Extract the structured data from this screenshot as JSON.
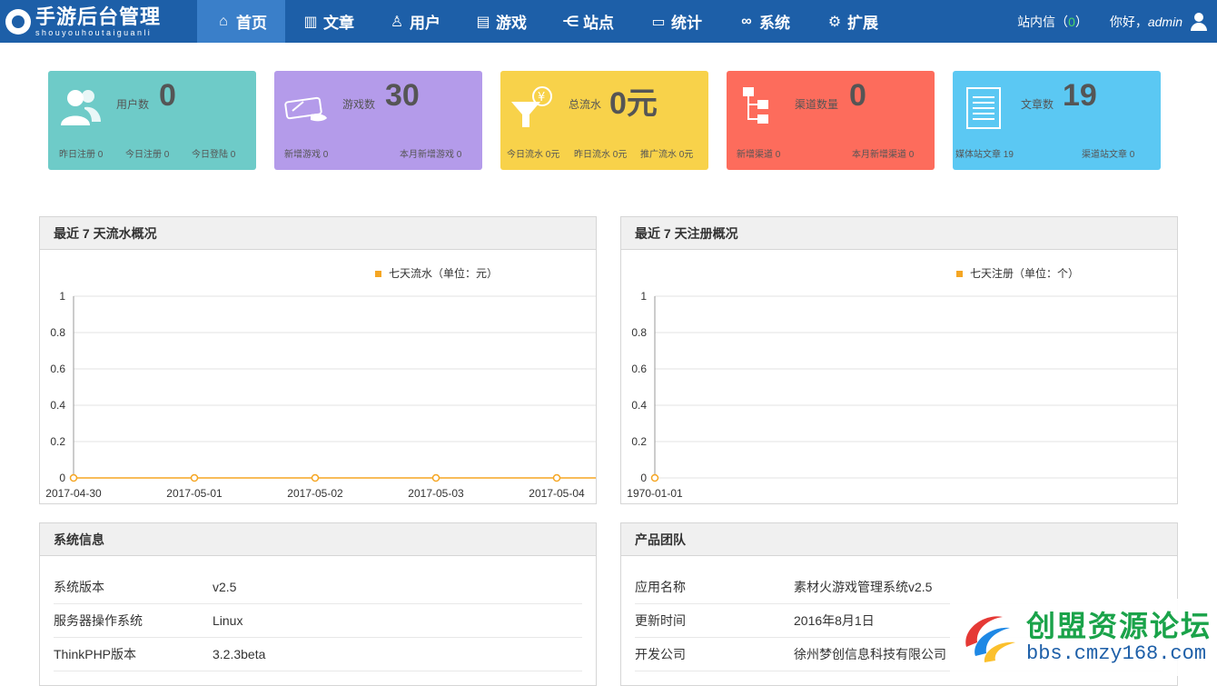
{
  "brand": {
    "title": "手游后台管理",
    "subtitle": "shouyouhoutaiguanli"
  },
  "nav": [
    {
      "label": "首页",
      "icon": "home-icon",
      "glyph": "⌂",
      "active": true
    },
    {
      "label": "文章",
      "icon": "bar-chart-icon",
      "glyph": "▥",
      "active": false
    },
    {
      "label": "用户",
      "icon": "user-sitemap-icon",
      "glyph": "♙",
      "active": false
    },
    {
      "label": "游戏",
      "icon": "document-icon",
      "glyph": "▤",
      "active": false
    },
    {
      "label": "站点",
      "icon": "share-icon",
      "glyph": "⋲",
      "active": false
    },
    {
      "label": "统计",
      "icon": "monitor-icon",
      "glyph": "▭",
      "active": false
    },
    {
      "label": "系统",
      "icon": "link-icon",
      "glyph": "∞",
      "active": false
    },
    {
      "label": "扩展",
      "icon": "gear-icon",
      "glyph": "⚙",
      "active": false
    }
  ],
  "topright": {
    "messages_label": "站内信（",
    "messages_count": "0",
    "messages_close": "）",
    "greeting": "你好，",
    "user": "admin"
  },
  "cards": [
    {
      "label": "用户数",
      "value": "0",
      "color": "#6ecbc8",
      "subs": [
        "昨日注册 0",
        "今日注册 0",
        "今日登陆 0"
      ]
    },
    {
      "label": "游戏数",
      "value": "30",
      "color": "#b49bea",
      "subs": [
        "新增游戏 0",
        "本月新增游戏 0"
      ]
    },
    {
      "label": "总流水",
      "value": "0元",
      "color": "#f8d24a",
      "subs": [
        "今日流水 0元",
        "昨日流水 0元",
        "推广流水 0元"
      ]
    },
    {
      "label": "渠道数量",
      "value": "0",
      "color": "#fd6c5c",
      "subs": [
        "新增渠道 0",
        "本月新增渠道 0"
      ]
    },
    {
      "label": "文章数",
      "value": "19",
      "color": "#5bc8f3",
      "subs": [
        "媒体站文章 19",
        "渠道站文章 0"
      ]
    }
  ],
  "panels": {
    "revenue_title": "最近 7 天流水概况",
    "register_title": "最近 7 天注册概况",
    "system_title": "系统信息",
    "team_title": "产品团队"
  },
  "chart_data": [
    {
      "type": "line",
      "legend": [
        "七天流水（单位：元）"
      ],
      "x": [
        "2017-04-30",
        "2017-05-01",
        "2017-05-02",
        "2017-05-03",
        "2017-05-04"
      ],
      "series": [
        {
          "name": "七天流水（单位：元）",
          "values": [
            0,
            0,
            0,
            0,
            0
          ],
          "color": "#f5a623"
        }
      ],
      "yticks": [
        "1",
        "0.8",
        "0.6",
        "0.4",
        "0.2",
        "0"
      ],
      "ylim": [
        0,
        1
      ],
      "grid": true
    },
    {
      "type": "line",
      "legend": [
        "七天注册（单位：个）"
      ],
      "x": [
        "1970-01-01"
      ],
      "series": [
        {
          "name": "七天注册（单位：个）",
          "values": [
            0
          ],
          "color": "#f5a623"
        }
      ],
      "yticks": [
        "1",
        "0.8",
        "0.6",
        "0.4",
        "0.2",
        "0"
      ],
      "ylim": [
        0,
        1
      ],
      "grid": true
    }
  ],
  "system_info": [
    {
      "k": "系统版本",
      "v": "v2.5"
    },
    {
      "k": "服务器操作系统",
      "v": "Linux"
    },
    {
      "k": "ThinkPHP版本",
      "v": "3.2.3beta"
    }
  ],
  "team_info": [
    {
      "k": "应用名称",
      "v": "素材火游戏管理系统v2.5"
    },
    {
      "k": "更新时间",
      "v": "2016年8月1日"
    },
    {
      "k": "开发公司",
      "v": "徐州梦创信息科技有限公司"
    }
  ],
  "watermark": {
    "title": "创盟资源论坛",
    "url": "bbs.cmzy168.com"
  }
}
